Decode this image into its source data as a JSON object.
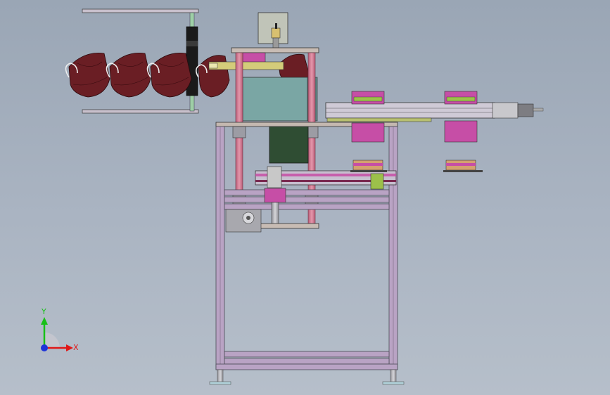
{
  "triad": {
    "x_label": "X",
    "y_label": "Y",
    "colors": {
      "x": "#e01818",
      "y": "#18c018",
      "z": "#1e34d8"
    }
  },
  "colors": {
    "background_top": "#9aa6b5",
    "frame": "#b9a3c4",
    "column": "#d9839a",
    "mask": "#6a1e24",
    "cabinet": "#7aa6a4",
    "motor": "#2f4d33",
    "plate": "#c4b8b0",
    "bracket": "#c64ea6",
    "rail": "#c7bfcf"
  }
}
